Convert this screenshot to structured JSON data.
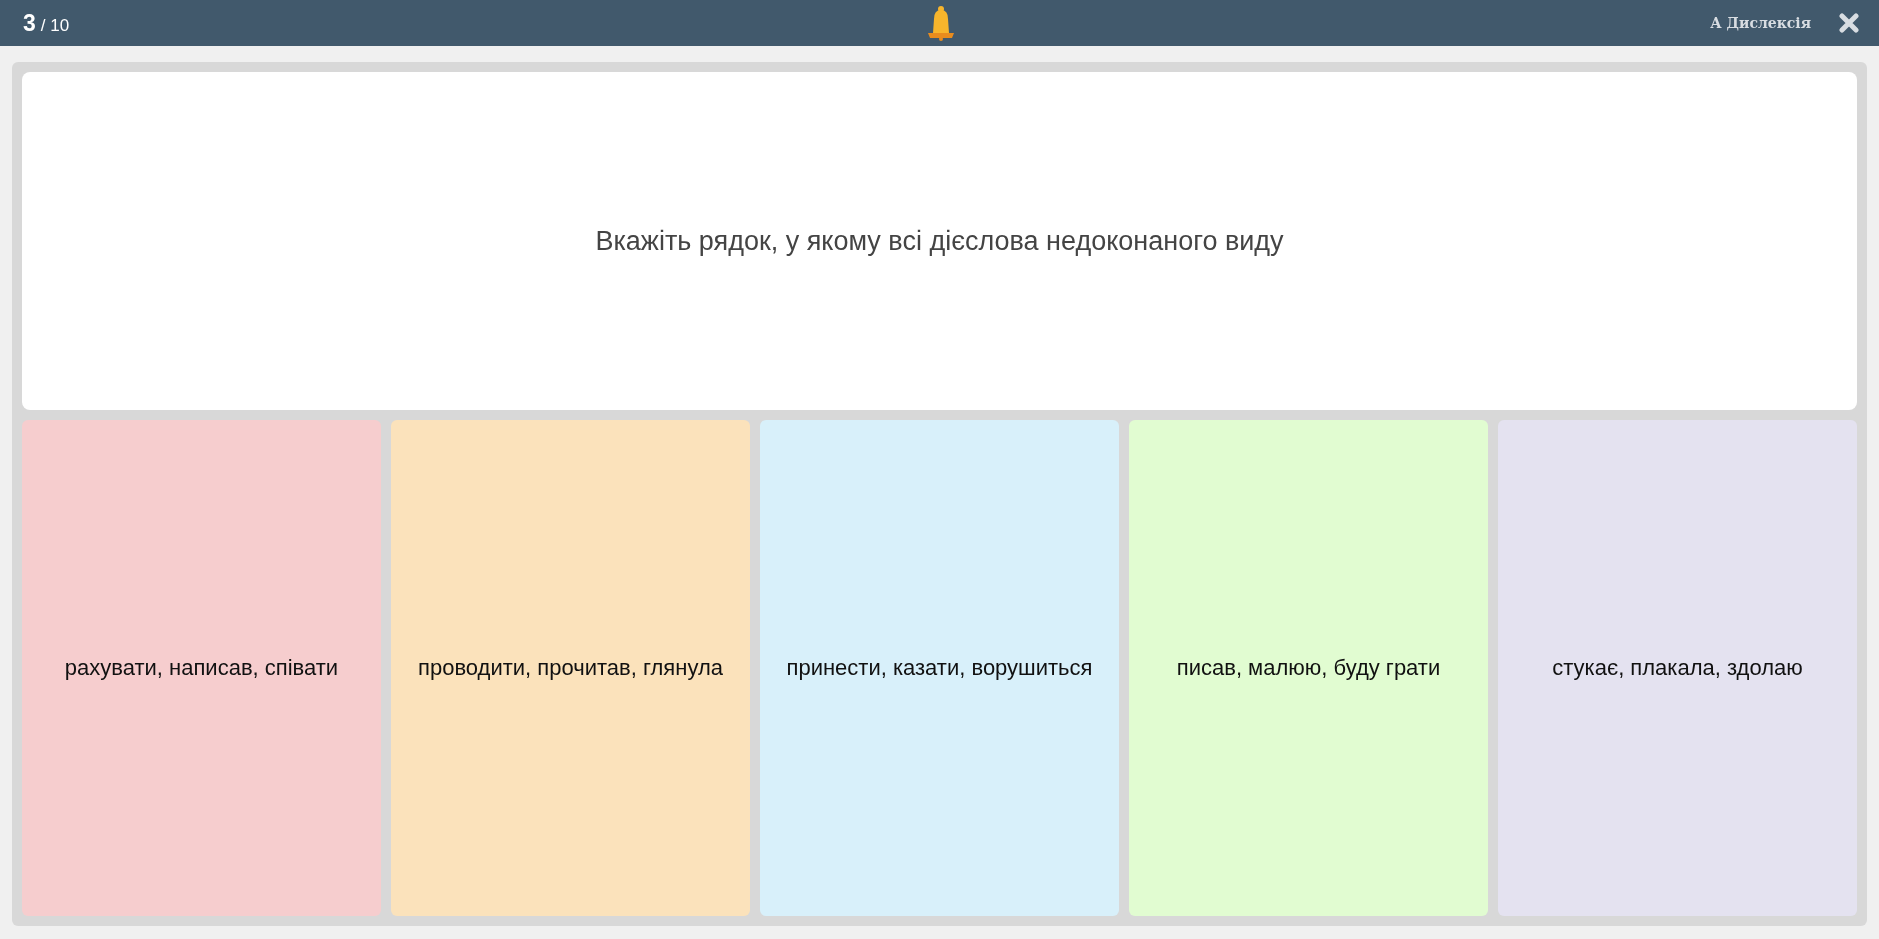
{
  "top_bar": {
    "current": "3",
    "total": "/ 10",
    "dyslexia_button": "А Дислексія"
  },
  "question": "Вкажіть рядок, у якому всі дієслова недоконаного виду",
  "answers": [
    {
      "text": "рахувати, написав, співати",
      "color": "#f6cdce"
    },
    {
      "text": "проводити, прочитав, глянула",
      "color": "#fbe2bb"
    },
    {
      "text": "принести, казати, ворушиться",
      "color": "#d8f0fa"
    },
    {
      "text": "писав, малюю, буду грати",
      "color": "#e1fcd1"
    },
    {
      "text": "стукає, плакала, здолаю",
      "color": "#e4e2f0"
    }
  ]
}
